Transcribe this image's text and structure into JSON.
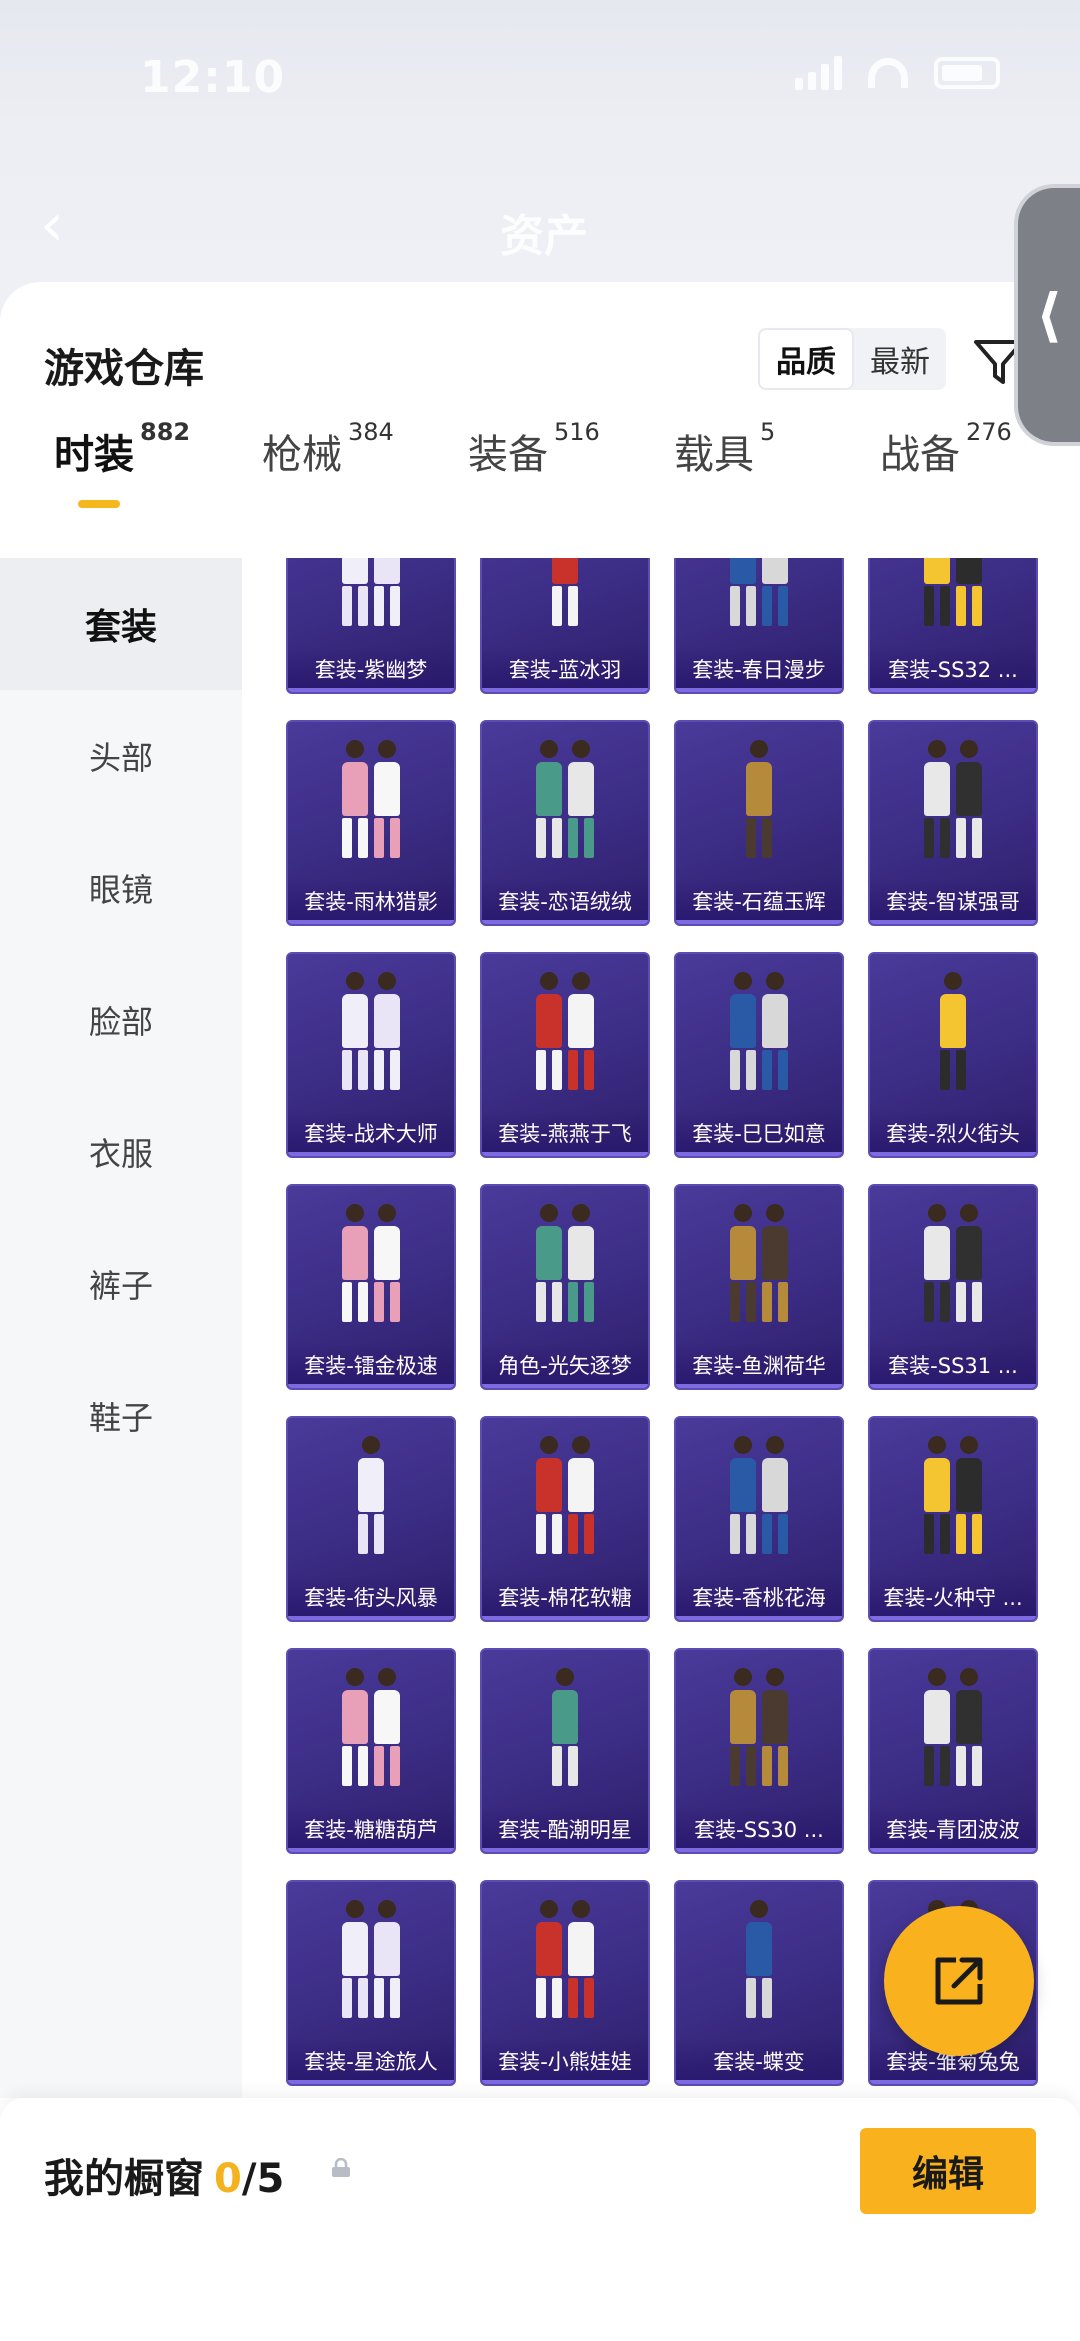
{
  "status": {
    "time": "12:10"
  },
  "nav": {
    "title": "资产"
  },
  "sheet": {
    "title": "游戏仓库",
    "sort_options": [
      "品质",
      "最新"
    ],
    "active_sort": 0
  },
  "tabs": [
    {
      "label": "时装",
      "count": "882"
    },
    {
      "label": "枪械",
      "count": "384"
    },
    {
      "label": "装备",
      "count": "516"
    },
    {
      "label": "载具",
      "count": "5"
    },
    {
      "label": "战备",
      "count": "276"
    }
  ],
  "sidebar": [
    "套装",
    "头部",
    "眼镜",
    "脸部",
    "衣服",
    "裤子",
    "鞋子"
  ],
  "items": [
    "套装-紫幽梦",
    "套装-蓝冰羽",
    "套装-春日漫步",
    "套装-SS32 ...",
    "套装-雨林猎影",
    "套装-恋语绒绒",
    "套装-石蕴玉辉",
    "套装-智谋强哥",
    "套装-战术大师",
    "套装-燕燕于飞",
    "套装-巳巳如意",
    "套装-烈火街头",
    "套装-镭金极速",
    "角色-光矢逐梦",
    "套装-鱼渊荷华",
    "套装-SS31 ...",
    "套装-街头风暴",
    "套装-棉花软糖",
    "套装-香桃花海",
    "套装-火种守 ...",
    "套装-糖糖葫芦",
    "套装-酷潮明星",
    "套装-SS30 ...",
    "套装-青团波波",
    "套装-星途旅人",
    "套装-小熊娃娃",
    "套装-蝶变",
    "套装-雏菊兔兔"
  ],
  "bottom": {
    "title": "我的橱窗",
    "count": "0",
    "sep_total": "/5",
    "edit_label": "编辑"
  },
  "colors": {
    "accent": "#f9b21d",
    "card_bg": "#3b2c84"
  }
}
